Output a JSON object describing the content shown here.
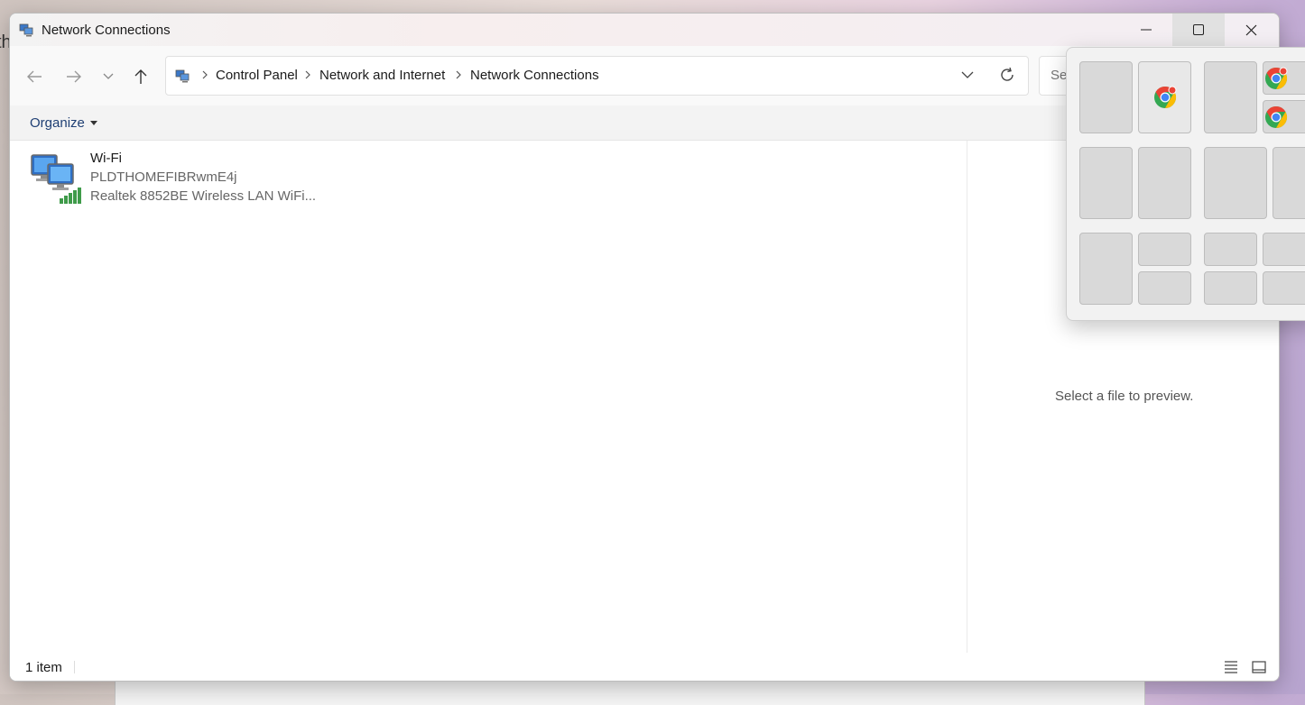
{
  "background": {
    "edge_text": "th"
  },
  "window": {
    "title": "Network Connections",
    "controls": {
      "minimize": "minimize-icon",
      "maximize": "maximize-icon",
      "close": "close-icon"
    }
  },
  "navigation": {
    "breadcrumbs": [
      "Control Panel",
      "Network and Internet",
      "Network Connections"
    ],
    "search_placeholder": "Search Network Connections"
  },
  "command_bar": {
    "organize_label": "Organize"
  },
  "items": [
    {
      "name": "Wi-Fi",
      "network": "PLDTHOMEFIBRwmE4j",
      "adapter": "Realtek 8852BE Wireless LAN WiFi..."
    }
  ],
  "preview": {
    "empty_text": "Select a file to preview."
  },
  "status": {
    "count": "1 item"
  },
  "snap_layouts": {
    "icons": [
      "chrome-icon"
    ],
    "accent": "#ea4335"
  }
}
